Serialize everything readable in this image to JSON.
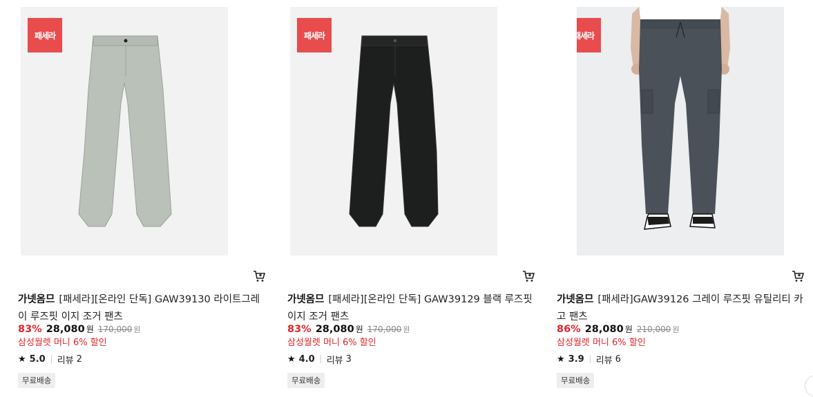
{
  "products": [
    {
      "badge": "패세라",
      "brand": "가넷옴므",
      "name": "[패세라][온라인 단독] GAW39130 라이트그레이 루즈핏 이지 조거 팬츠",
      "discount": "83%",
      "price": "28,080",
      "currency": "원",
      "original_price": "170,000",
      "promo": "삼성월렛 머니 6% 할인",
      "rating": "5.0",
      "review_label": "리뷰",
      "review_count": "2",
      "shipping": "무료배송",
      "pants_color": "#b9c1b8"
    },
    {
      "badge": "패세라",
      "brand": "가넷옴므",
      "name": "[패세라][온라인 단독] GAW39129 블랙 루즈핏 이지 조거 팬츠",
      "discount": "83%",
      "price": "28,080",
      "currency": "원",
      "original_price": "170,000",
      "promo": "삼성월렛 머니 6% 할인",
      "rating": "4.0",
      "review_label": "리뷰",
      "review_count": "3",
      "shipping": "무료배송",
      "pants_color": "#1d1f1e"
    },
    {
      "badge": "패세라",
      "brand": "가넷옴므",
      "name": "[패세라]GAW39126 그레이 루즈핏 유틸리티 카고 팬츠",
      "discount": "86%",
      "price": "28,080",
      "currency": "원",
      "original_price": "210,000",
      "promo": "삼성월렛 머니 6% 할인",
      "rating": "3.9",
      "review_label": "리뷰",
      "review_count": "6",
      "shipping": "무료배송",
      "pants_color": "#4a5158"
    }
  ],
  "icons": {
    "cart": "cart-icon",
    "star": "star-icon"
  },
  "colors": {
    "badge": "#e84c4c",
    "discount": "#e3242b",
    "promo": "#e3242b"
  }
}
